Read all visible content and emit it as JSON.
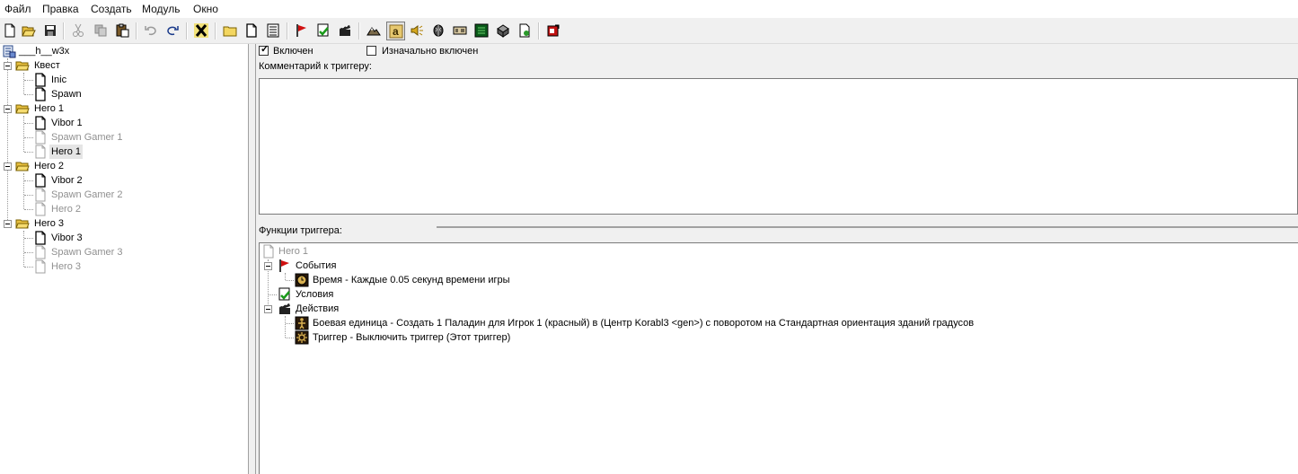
{
  "menu": [
    "Файл",
    "Правка",
    "Создать",
    "Модуль",
    "Окно"
  ],
  "toolbar": {
    "buttons": [
      "new-file",
      "open-folder",
      "save",
      "cut",
      "copy",
      "paste",
      "undo",
      "redo",
      "delete",
      "new-category",
      "new-trigger",
      "new-comment",
      "new-event",
      "new-condition",
      "new-action",
      "terrain-editor",
      "object-editor",
      "sound-editor",
      "ai-editor",
      "campaign-editor",
      "import-manager",
      "object-manager",
      "test-map",
      "trigger-editor"
    ]
  },
  "tree": {
    "root": "___h__w3x",
    "folders": [
      {
        "label": "Квест",
        "items": [
          {
            "label": "Inic",
            "disabled": false
          },
          {
            "label": "Spawn",
            "disabled": false
          }
        ]
      },
      {
        "label": "Hero 1",
        "items": [
          {
            "label": "Vibor 1",
            "disabled": false
          },
          {
            "label": "Spawn Gamer 1",
            "disabled": true
          },
          {
            "label": "Hero 1",
            "disabled": false,
            "selected": true
          }
        ]
      },
      {
        "label": "Hero 2",
        "items": [
          {
            "label": "Vibor 2",
            "disabled": false
          },
          {
            "label": "Spawn Gamer 2",
            "disabled": true
          },
          {
            "label": "Hero 2",
            "disabled": true
          }
        ]
      },
      {
        "label": "Hero 3",
        "items": [
          {
            "label": "Vibor 3",
            "disabled": false
          },
          {
            "label": "Spawn Gamer 3",
            "disabled": true
          },
          {
            "label": "Hero 3",
            "disabled": true
          }
        ]
      }
    ]
  },
  "trigger": {
    "enabled_label": "Включен",
    "enabled_checked": true,
    "initially_on_label": "Изначально включен",
    "initially_on_checked": false,
    "comment_label": "Комментарий к триггеру:",
    "comment_value": "",
    "functions_label": "Функции триггера:",
    "functions": {
      "root": "Hero 1",
      "events_label": "События",
      "events": [
        "Время - Каждые 0.05 секунд времени игры"
      ],
      "conditions_label": "Условия",
      "actions_label": "Действия",
      "actions": [
        "Боевая единица - Создать 1 Паладин для Игрок 1 (красный) в (Центр Korabl3 <gen>) с поворотом на Стандартная ориентация зданий градусов",
        "Триггер - Выключить триггер (Этот триггер)"
      ]
    }
  },
  "colors": {
    "accent_red": "#d01010",
    "folder_yellow": "#f3d660",
    "disabled_text": "#909090"
  }
}
